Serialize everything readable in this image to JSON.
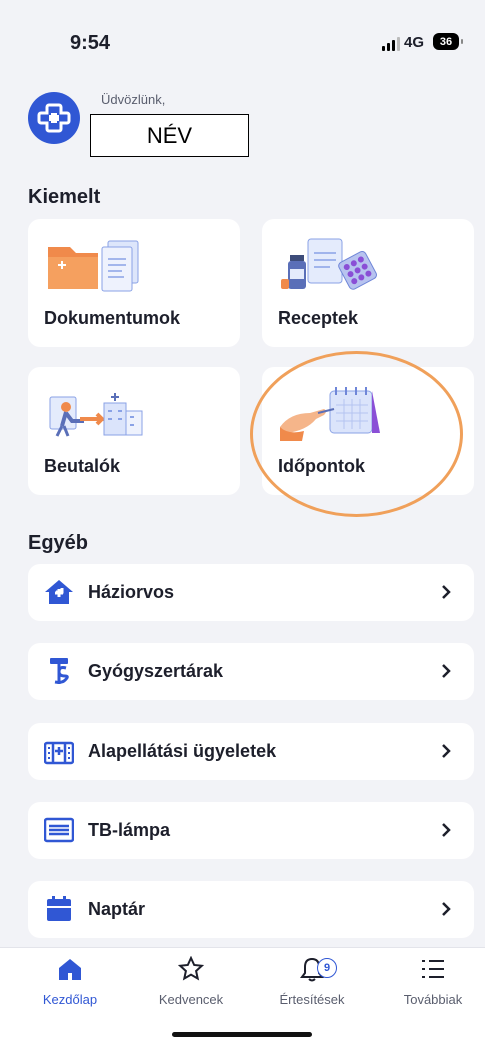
{
  "status": {
    "time": "9:54",
    "network": "4G",
    "battery": "36"
  },
  "header": {
    "greeting": "Üdvözlünk,",
    "name": "NÉV"
  },
  "featured": {
    "title": "Kiemelt",
    "tiles": [
      {
        "label": "Dokumentumok",
        "icon": "documents-folder-icon"
      },
      {
        "label": "Receptek",
        "icon": "prescriptions-icon"
      },
      {
        "label": "Beutalók",
        "icon": "referrals-icon"
      },
      {
        "label": "Időpontok",
        "icon": "appointments-calendar-icon"
      }
    ]
  },
  "other": {
    "title": "Egyéb",
    "items": [
      {
        "label": "Háziorvos",
        "icon": "house-medical-icon"
      },
      {
        "label": "Gyógyszertárak",
        "icon": "pharmacy-icon"
      },
      {
        "label": "Alapellátási ügyeletek",
        "icon": "hospital-building-icon"
      },
      {
        "label": "TB-lámpa",
        "icon": "list-box-icon"
      },
      {
        "label": "Naptár",
        "icon": "calendar-icon"
      }
    ]
  },
  "tabbar": {
    "items": [
      {
        "label": "Kezdőlap",
        "icon": "home-icon",
        "active": true
      },
      {
        "label": "Kedvencek",
        "icon": "star-icon"
      },
      {
        "label": "Értesítések",
        "icon": "bell-icon",
        "badge": "9"
      },
      {
        "label": "Továbbiak",
        "icon": "menu-list-icon"
      }
    ]
  },
  "colors": {
    "accent": "#3057d4",
    "highlight_ring": "#f0a05a",
    "background": "#f2f3f7"
  }
}
